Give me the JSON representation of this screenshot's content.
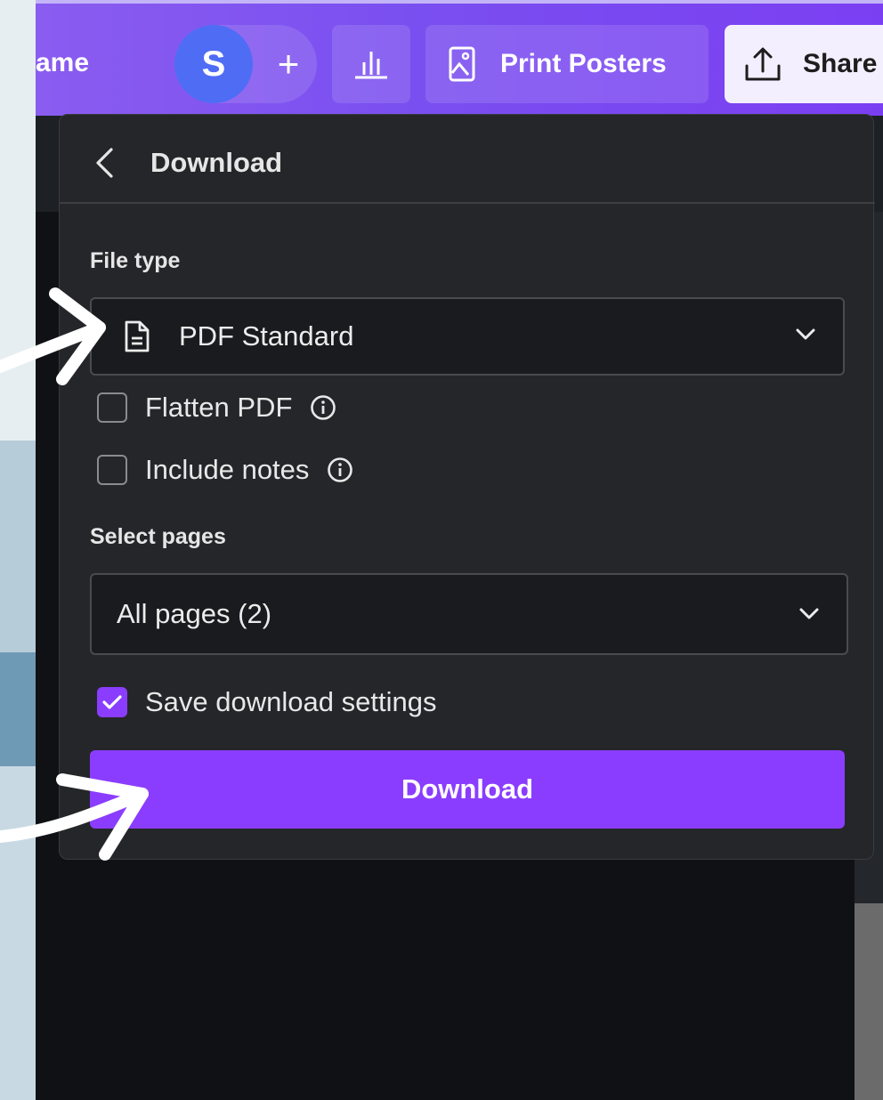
{
  "topbar": {
    "name_fragment": "ame",
    "avatar_initial": "S",
    "add_symbol": "+",
    "print_label": "Print Posters",
    "share_label": "Share",
    "icons": [
      "plus-icon",
      "chart-icon",
      "image-frame-icon",
      "upload-icon"
    ]
  },
  "download_panel": {
    "title": "Download",
    "file_type_label": "File type",
    "file_type_value": "PDF Standard",
    "flatten_pdf_label": "Flatten PDF",
    "flatten_pdf_checked": false,
    "include_notes_label": "Include notes",
    "include_notes_checked": false,
    "select_pages_label": "Select pages",
    "select_pages_value": "All pages (2)",
    "save_settings_label": "Save download settings",
    "save_settings_checked": true,
    "download_button_label": "Download"
  },
  "colors": {
    "accent": "#8b3dff",
    "topbar_gradient_start": "#8a5cf0",
    "panel_bg": "#252629",
    "avatar_bg": "#4f6cf5"
  }
}
